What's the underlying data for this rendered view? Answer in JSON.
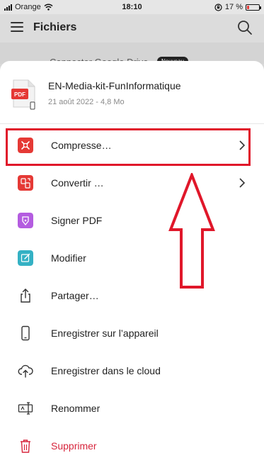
{
  "status": {
    "carrier": "Orange",
    "time": "18:10",
    "battery": "17 %",
    "battery_level": 0.17,
    "battery_color": "#e53935"
  },
  "header": {
    "title": "Fichiers"
  },
  "behind": {
    "text": "Connecter Google Drive",
    "badge": "Nouveau"
  },
  "file": {
    "icon_label": "PDF",
    "name": "EN-Media-kit-FunInformatique",
    "meta": "21 août 2022 - 4,8 Mo"
  },
  "actions": [
    {
      "label": "Compresse…",
      "icon": "compress-icon",
      "color": "#e53935",
      "has_submenu": true
    },
    {
      "label": "Convertir …",
      "icon": "convert-icon",
      "color": "#e53935",
      "has_submenu": true
    },
    {
      "label": "Signer PDF",
      "icon": "sign-pdf-icon",
      "color": "#b45ce0",
      "has_submenu": false
    },
    {
      "label": "Modifier",
      "icon": "edit-icon",
      "color": "#34b1c4",
      "has_submenu": false
    },
    {
      "label": "Partager…",
      "icon": "share-icon",
      "color": "#333333",
      "has_submenu": false
    },
    {
      "label": "Enregistrer sur l’appareil",
      "icon": "phone-icon",
      "color": "#333333",
      "has_submenu": false
    },
    {
      "label": "Enregistrer dans le cloud",
      "icon": "cloud-upload-icon",
      "color": "#333333",
      "has_submenu": false
    },
    {
      "label": "Renommer",
      "icon": "rename-icon",
      "color": "#333333",
      "has_submenu": false
    },
    {
      "label": "Supprimer",
      "icon": "trash-icon",
      "color": "#d7263d",
      "has_submenu": false
    }
  ],
  "annotation": {
    "color": "#e0172a"
  }
}
